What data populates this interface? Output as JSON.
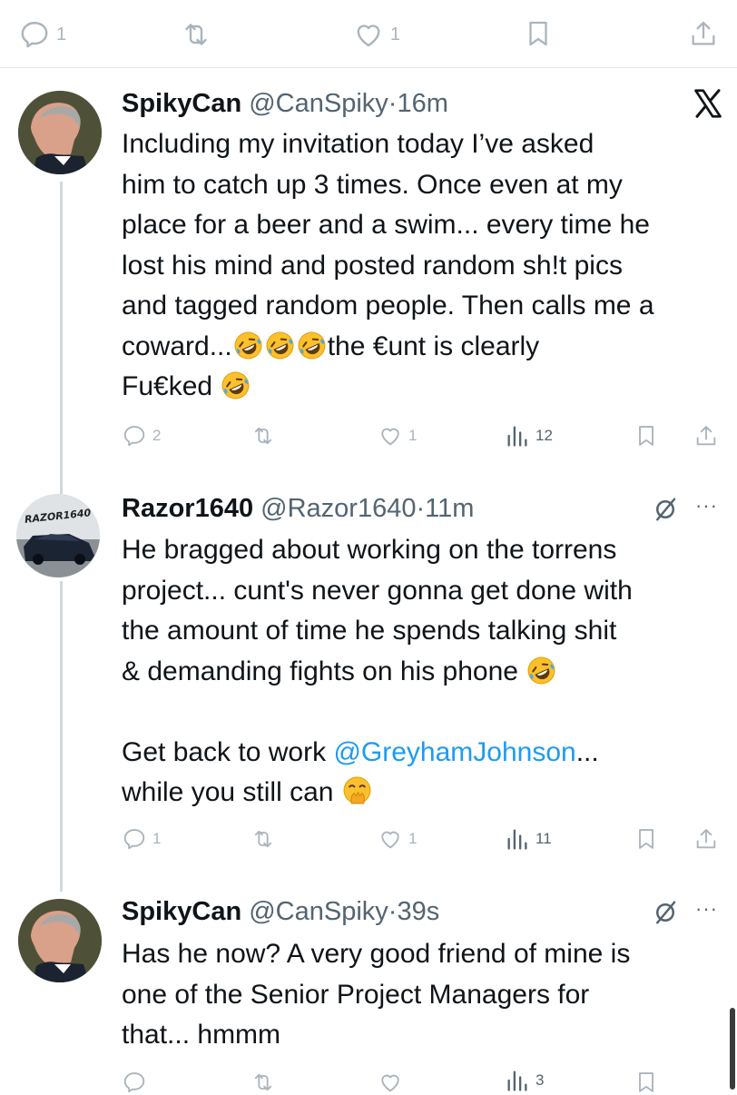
{
  "top_actions": {
    "reply_count": "1",
    "retweet_count": "",
    "like_count": "1"
  },
  "tweets": [
    {
      "name": "SpikyCan",
      "handle": "@CanSpiky",
      "dot": "·",
      "time": "16m",
      "header_icon": "x-logo-icon",
      "body_lines": [
        "Including my invitation today I’ve asked",
        "him to catch up 3 times. Once even at my",
        "place for a beer and a swim... every time he",
        "lost his mind and posted random sh!t pics",
        "and tagged random people. Then calls me a"
      ],
      "body_line6_a": "coward...",
      "body_line6_b": "the €unt is clearly",
      "body_line7": "Fu€ked",
      "reply_count": "2",
      "like_count": "1",
      "views": "12"
    },
    {
      "name": "Razor1640",
      "handle": "@Razor1640",
      "dot": "·",
      "time": "11m",
      "header_icon": "mute-icon",
      "avatar_text": "RAZOR1640",
      "body_lines": [
        "He bragged about working on the torrens",
        "project... cunt's never gonna get done with",
        "the amount of time he spends talking shit"
      ],
      "body_line4": "& demanding fights on his phone",
      "body_line5_a": "Get back to work ",
      "mention": "@GreyhamJohnson",
      "body_line5_b": "...",
      "body_line6": "while you still can",
      "reply_count": "1",
      "like_count": "1",
      "views": "11"
    },
    {
      "name": "SpikyCan",
      "handle": "@CanSpiky",
      "dot": "·",
      "time": "39s",
      "header_icon": "mute-icon",
      "body_lines": [
        "Has he now? A very good friend of mine is",
        "one of the Senior Project Managers for",
        "that... hmmm"
      ],
      "views": "3"
    }
  ],
  "more_glyph": "···",
  "colors": {
    "link": "#1d9bf0",
    "text": "#0f1419",
    "muted": "#536471",
    "icon": "#aab4bd"
  }
}
